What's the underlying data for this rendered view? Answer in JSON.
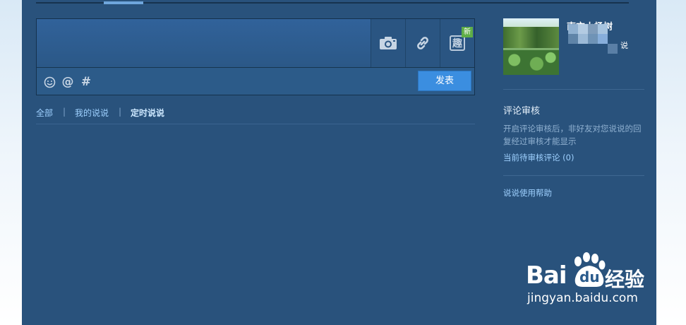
{
  "composer": {
    "input_placeholder": "",
    "tools": [
      {
        "name": "photo",
        "icon": "camera-icon"
      },
      {
        "name": "link",
        "icon": "link-icon"
      },
      {
        "name": "fun",
        "icon_text": "趣",
        "badge": "新"
      }
    ],
    "bar_icons": [
      "emoji-icon",
      "mention-icon",
      "hashtag-icon"
    ],
    "bar_glyphs": {
      "mention": "@",
      "hashtag": "#"
    },
    "publish_label": "发表"
  },
  "filters": {
    "all": "全部",
    "mine": "我的说说",
    "scheduled": "定时说说",
    "separator": "|"
  },
  "sidebar": {
    "user_name": "南方小杨树",
    "stat_suffix": "说",
    "review_heading": "评论审核",
    "review_desc": "开启评论审核后，非好友对您说说的回复经过审核才能显示",
    "pending_link": "当前待审核评论 (0)",
    "help_link": "说说使用帮助"
  },
  "watermark": {
    "brand_left": "Bai",
    "brand_mid": "du",
    "brand_right": "经验",
    "url": "jingyan.baidu.com"
  },
  "colors": {
    "panel_bg": "#29527c",
    "publish_btn": "#3b8ee0",
    "link": "#9fd1ff",
    "new_badge": "#5fae47"
  }
}
